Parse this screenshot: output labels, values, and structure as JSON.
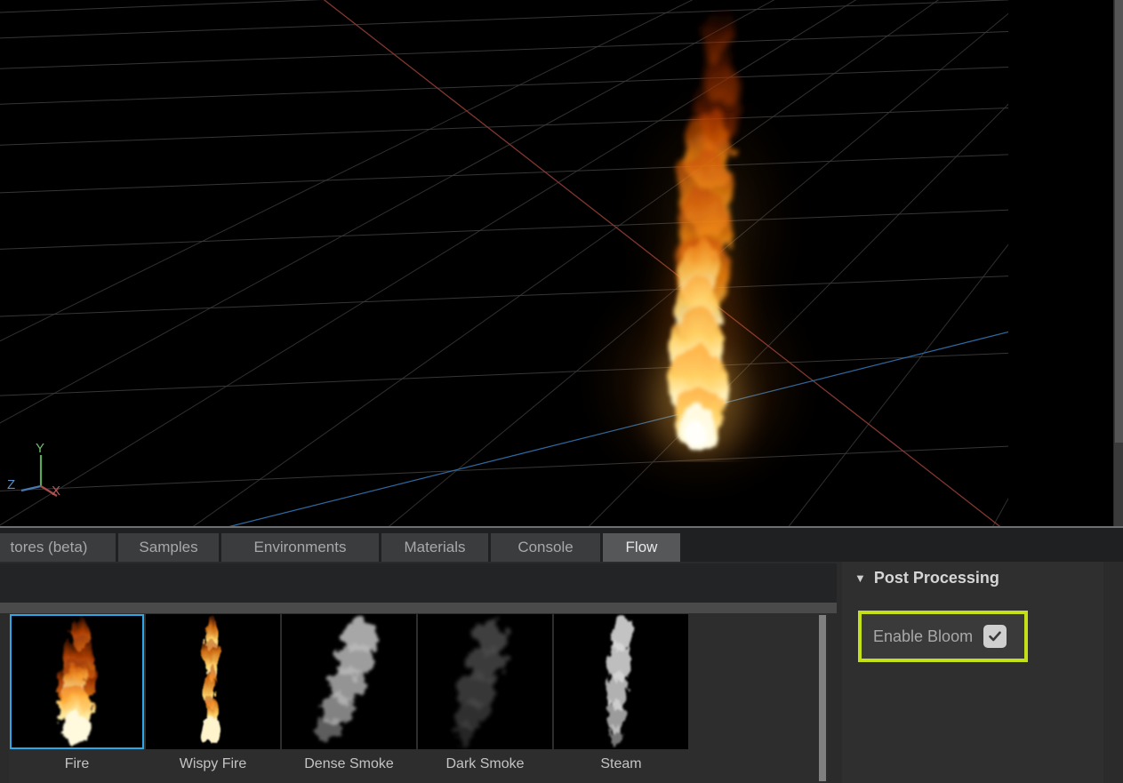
{
  "app": {
    "viewport": {
      "name": "3d-render-viewport",
      "background": "#000000",
      "grid_color": "#3a3a3a",
      "axis_gizmo": {
        "labels": [
          "Y",
          "X",
          "Z"
        ],
        "y_color": "#5aa85a",
        "x_color": "#a84a4a",
        "z_color": "#4a78b0"
      },
      "scene_axes": {
        "x_axis_color": "#7a3030",
        "z_axis_color": "#2f5f8f"
      },
      "effect": "Fire"
    }
  },
  "tabs": [
    {
      "label": "tores (beta)",
      "active": false,
      "clipped": true
    },
    {
      "label": "Samples",
      "active": false
    },
    {
      "label": "Environments",
      "active": false
    },
    {
      "label": "Materials",
      "active": false
    },
    {
      "label": "Console",
      "active": false
    },
    {
      "label": "Flow",
      "active": true
    }
  ],
  "gallery": {
    "search_placeholder": "",
    "items": [
      {
        "label": "Fire",
        "selected": true,
        "kind": "fire"
      },
      {
        "label": "Wispy Fire",
        "selected": false,
        "kind": "wispy-fire"
      },
      {
        "label": "Dense Smoke",
        "selected": false,
        "kind": "dense-smoke"
      },
      {
        "label": "Dark Smoke",
        "selected": false,
        "kind": "dark-smoke"
      },
      {
        "label": "Steam",
        "selected": false,
        "kind": "steam"
      }
    ],
    "selection_color": "#2ca7e8"
  },
  "post_processing": {
    "caret": "▼",
    "title": "Post Processing",
    "bloom_label": "Enable Bloom",
    "bloom_checked": true,
    "highlight_color": "#c4e019"
  }
}
